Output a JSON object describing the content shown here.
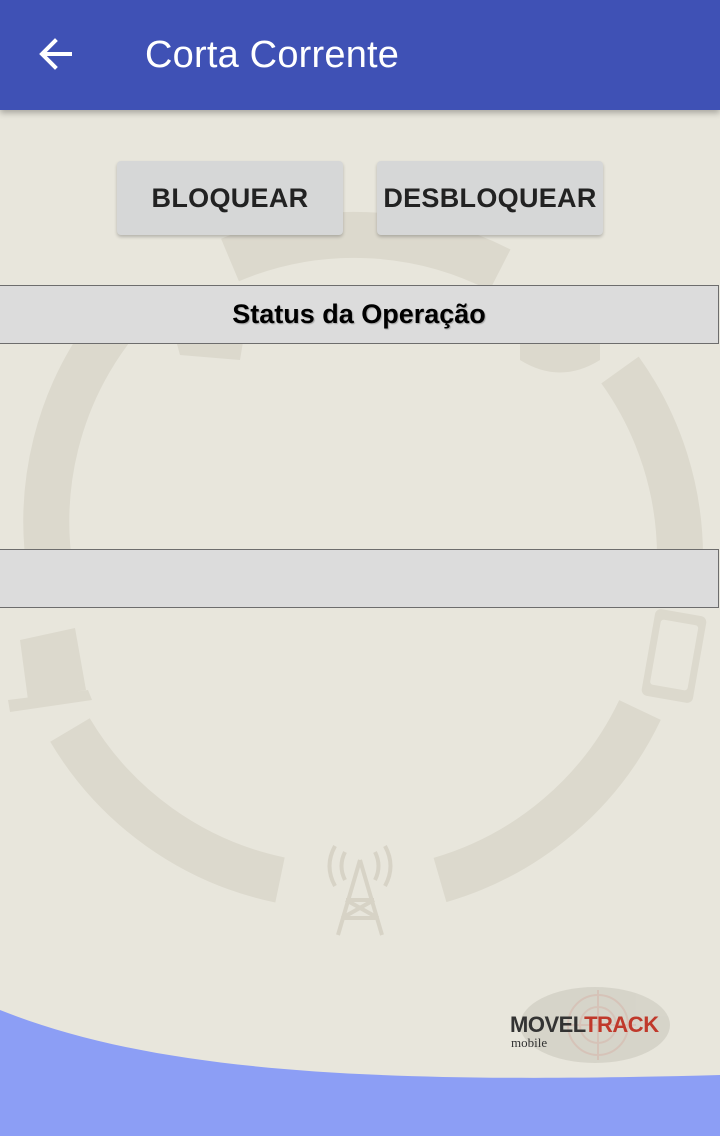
{
  "app_bar": {
    "title": "Corta Corrente",
    "back_icon": "arrow-left-icon",
    "color": "#3f51b5"
  },
  "actions": {
    "block_label": "BLOQUEAR",
    "unblock_label": "DESBLOQUEAR"
  },
  "status": {
    "header_label": "Status da Operação",
    "value": ""
  },
  "logo": {
    "part1": "MOVEL",
    "part2": "TRACK",
    "sub": "mobile",
    "color_part1": "#333333",
    "color_part2": "#c0392b"
  },
  "colors": {
    "background": "#e8e6dc",
    "footer_wave": "#8c9ef5"
  }
}
